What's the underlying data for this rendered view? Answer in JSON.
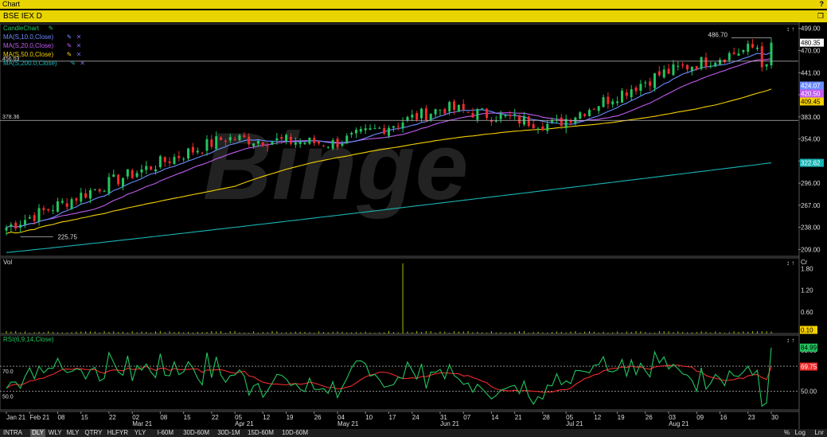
{
  "window": {
    "title": "Chart"
  },
  "symbol_bar": {
    "title": "BSE IEX D"
  },
  "legend": {
    "main": [
      {
        "label": "CandleChart",
        "color": "#22c55e"
      },
      {
        "label": "MA(S,10.0,Close)",
        "color": "#6b8cff"
      },
      {
        "label": "MA(S,20.0,Close)",
        "color": "#c15cf0"
      },
      {
        "label": "MA(S,50.0,Close)",
        "color": "#f5d000"
      },
      {
        "label": "MA(S,200.0,Close)",
        "color": "#19b3b3"
      }
    ],
    "vol": {
      "label": "Vol"
    },
    "rsi": {
      "label": "RSI(6,9,14,Close)",
      "color": "#22c55e"
    }
  },
  "price_axis": {
    "ticks": [
      "499.00",
      "470.00",
      "441.00",
      "412.00",
      "383.00",
      "354.00",
      "325.00",
      "296.00",
      "267.00",
      "238.00",
      "209.00"
    ]
  },
  "price_badges": [
    {
      "text": "480.35",
      "bg": "#ffffff",
      "fg": "#000000"
    },
    {
      "text": "424.07",
      "bg": "#6b8cff",
      "fg": "#ffffff"
    },
    {
      "text": "420.50",
      "bg": "#c15cf0",
      "fg": "#ffffff"
    },
    {
      "text": "409.45",
      "bg": "#f5d000",
      "fg": "#000000"
    },
    {
      "text": "322.62",
      "bg": "#19b3b3",
      "fg": "#ffffff"
    }
  ],
  "price_annotations": {
    "high_value": "486.70",
    "low_value": "225.75",
    "hline_upper": "456.03",
    "hline_lower": "378.36"
  },
  "vol_axis": {
    "unit": "Cr",
    "ticks": [
      "1.80",
      "1.20",
      "0.60"
    ],
    "badge": "0.10"
  },
  "rsi_axis": {
    "ticks": [
      "83.00",
      "50.00"
    ],
    "badge_green": "84.99",
    "badge_red": "69.75",
    "level_upper": "70.0",
    "level_lower": "50.0"
  },
  "watermark": "Binge",
  "time_axis": [
    {
      "label": "Jan 21",
      "month": true
    },
    {
      "label": "Feb 21",
      "month": true
    },
    {
      "label": "08"
    },
    {
      "label": "15"
    },
    {
      "label": "22"
    },
    {
      "label": "02",
      "sub": "Mar 21"
    },
    {
      "label": "08"
    },
    {
      "label": "15"
    },
    {
      "label": "22"
    },
    {
      "label": "05",
      "sub": "Apr 21"
    },
    {
      "label": "12"
    },
    {
      "label": "19"
    },
    {
      "label": "26"
    },
    {
      "label": "04",
      "sub": "May 21"
    },
    {
      "label": "10"
    },
    {
      "label": "17"
    },
    {
      "label": "24"
    },
    {
      "label": "31",
      "sub": "Jun 21"
    },
    {
      "label": "07"
    },
    {
      "label": "14"
    },
    {
      "label": "21"
    },
    {
      "label": "28"
    },
    {
      "label": "05",
      "sub": "Jul 21"
    },
    {
      "label": "12"
    },
    {
      "label": "19"
    },
    {
      "label": "26"
    },
    {
      "label": "03",
      "sub": "Aug 21"
    },
    {
      "label": "09"
    },
    {
      "label": "16"
    },
    {
      "label": "23"
    },
    {
      "label": "30"
    }
  ],
  "bottom_bar": {
    "periods": [
      "INTRA",
      "DLY",
      "WLY",
      "MLY",
      "QTRY",
      "HLFYR",
      "YLY"
    ],
    "selected": "DLY",
    "intervals": [
      "I-60M",
      "30D-60M",
      "30D-1M",
      "15D-60M",
      "10D-60M"
    ],
    "right": [
      "%",
      "Log",
      "Lnr"
    ]
  },
  "chart_data": {
    "type": "candlestick",
    "title": "BSE IEX D",
    "x_range": [
      "Jan 21",
      "Aug 30 21"
    ],
    "price_ylim": [
      200,
      505
    ],
    "monthly_closes": [
      {
        "month": "Jan 21",
        "value": 238
      },
      {
        "month": "Feb 21",
        "value": 300
      },
      {
        "month": "Mar 21",
        "value": 355
      },
      {
        "month": "Apr 21",
        "value": 348
      },
      {
        "month": "May 21",
        "value": 395
      },
      {
        "month": "Jun 21",
        "value": 372
      },
      {
        "month": "Jul 21",
        "value": 440
      },
      {
        "month": "Aug 21",
        "value": 480.35
      }
    ],
    "last_values": {
      "close": 480.35,
      "ma10": 424.07,
      "ma20": 420.5,
      "ma50": 409.45,
      "ma200": 322.62
    },
    "period_high": 486.7,
    "period_low": 225.75,
    "horizontal_lines": [
      456.03,
      378.36
    ],
    "volume": {
      "unit": "Cr",
      "ylim": [
        0,
        2.1
      ],
      "spike": {
        "date": "May 17 21",
        "value": 1.95
      },
      "last": 0.1
    },
    "rsi": {
      "ylim": [
        35,
        95
      ],
      "levels": [
        70,
        50
      ],
      "last_fast": 84.99,
      "last_slow": 69.75
    }
  }
}
